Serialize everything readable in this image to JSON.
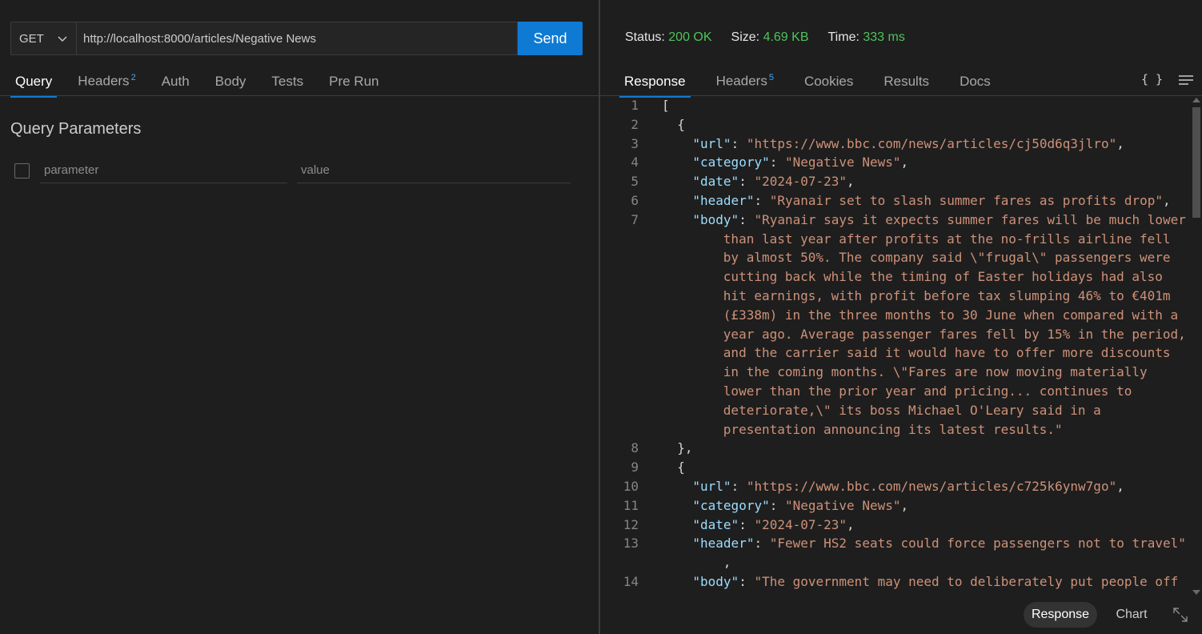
{
  "request": {
    "method": "GET",
    "url": "http://localhost:8000/articles/Negative News",
    "send_label": "Send"
  },
  "left_tabs": [
    {
      "label": "Query",
      "badge": "",
      "active": true
    },
    {
      "label": "Headers",
      "badge": "2",
      "active": false
    },
    {
      "label": "Auth",
      "badge": "",
      "active": false
    },
    {
      "label": "Body",
      "badge": "",
      "active": false
    },
    {
      "label": "Tests",
      "badge": "",
      "active": false
    },
    {
      "label": "Pre Run",
      "badge": "",
      "active": false
    }
  ],
  "query": {
    "title": "Query Parameters",
    "param_placeholder": "parameter",
    "value_placeholder": "value"
  },
  "status": {
    "status_label": "Status:",
    "status_value": "200 OK",
    "size_label": "Size:",
    "size_value": "4.69 KB",
    "time_label": "Time:",
    "time_value": "333 ms"
  },
  "right_tabs": [
    {
      "label": "Response",
      "badge": "",
      "active": true
    },
    {
      "label": "Headers",
      "badge": "5",
      "active": false
    },
    {
      "label": "Cookies",
      "badge": "",
      "active": false
    },
    {
      "label": "Results",
      "badge": "",
      "active": false
    },
    {
      "label": "Docs",
      "badge": "",
      "active": false
    }
  ],
  "braces_label": "{ }",
  "editor_lines": [
    {
      "ln": "1",
      "indent": 0,
      "parts": [
        [
          "punc",
          "["
        ]
      ]
    },
    {
      "ln": "2",
      "indent": 1,
      "parts": [
        [
          "punc",
          "{"
        ]
      ]
    },
    {
      "ln": "3",
      "indent": 2,
      "parts": [
        [
          "key",
          "\"url\""
        ],
        [
          "punc",
          ": "
        ],
        [
          "str",
          "\"https://www.bbc.com/news/articles/cj50d6q3jlro\""
        ],
        [
          "punc",
          ","
        ]
      ]
    },
    {
      "ln": "4",
      "indent": 2,
      "parts": [
        [
          "key",
          "\"category\""
        ],
        [
          "punc",
          ": "
        ],
        [
          "str",
          "\"Negative News\""
        ],
        [
          "punc",
          ","
        ]
      ]
    },
    {
      "ln": "5",
      "indent": 2,
      "parts": [
        [
          "key",
          "\"date\""
        ],
        [
          "punc",
          ": "
        ],
        [
          "str",
          "\"2024-07-23\""
        ],
        [
          "punc",
          ","
        ]
      ]
    },
    {
      "ln": "6",
      "indent": 2,
      "parts": [
        [
          "key",
          "\"header\""
        ],
        [
          "punc",
          ": "
        ],
        [
          "str",
          "\"Ryanair set to slash summer fares as profits drop\""
        ],
        [
          "punc",
          ","
        ]
      ]
    },
    {
      "ln": "7",
      "indent": 2,
      "parts": [
        [
          "key",
          "\"body\""
        ],
        [
          "punc",
          ": "
        ],
        [
          "str",
          "\"Ryanair says it expects summer fares will be much lower"
        ]
      ]
    },
    {
      "ln": "",
      "indent": 4,
      "parts": [
        [
          "str",
          "than last year after profits at the no-frills airline fell"
        ]
      ]
    },
    {
      "ln": "",
      "indent": 4,
      "parts": [
        [
          "str",
          "by almost 50%. The company said \\\"frugal\\\" passengers were"
        ]
      ]
    },
    {
      "ln": "",
      "indent": 4,
      "parts": [
        [
          "str",
          "cutting back while the timing of Easter holidays had also"
        ]
      ]
    },
    {
      "ln": "",
      "indent": 4,
      "parts": [
        [
          "str",
          "hit earnings, with profit before tax slumping 46% to €401m"
        ]
      ]
    },
    {
      "ln": "",
      "indent": 4,
      "parts": [
        [
          "str",
          "(£338m) in the three months to 30 June when compared with a"
        ]
      ]
    },
    {
      "ln": "",
      "indent": 4,
      "parts": [
        [
          "str",
          "year ago. Average passenger fares fell by 15% in the period,"
        ]
      ]
    },
    {
      "ln": "",
      "indent": 4,
      "parts": [
        [
          "str",
          "and the carrier said it would have to offer more discounts"
        ]
      ]
    },
    {
      "ln": "",
      "indent": 4,
      "parts": [
        [
          "str",
          "in the coming months. \\\"Fares are now moving materially"
        ]
      ]
    },
    {
      "ln": "",
      "indent": 4,
      "parts": [
        [
          "str",
          "lower than the prior year and pricing... continues to"
        ]
      ]
    },
    {
      "ln": "",
      "indent": 4,
      "parts": [
        [
          "str",
          "deteriorate,\\\" its boss Michael O'Leary said in a"
        ]
      ]
    },
    {
      "ln": "",
      "indent": 4,
      "parts": [
        [
          "str",
          "presentation announcing its latest results.\""
        ]
      ]
    },
    {
      "ln": "8",
      "indent": 1,
      "parts": [
        [
          "punc",
          "},"
        ]
      ]
    },
    {
      "ln": "9",
      "indent": 1,
      "parts": [
        [
          "punc",
          "{"
        ]
      ]
    },
    {
      "ln": "10",
      "indent": 2,
      "parts": [
        [
          "key",
          "\"url\""
        ],
        [
          "punc",
          ": "
        ],
        [
          "str",
          "\"https://www.bbc.com/news/articles/c725k6ynw7go\""
        ],
        [
          "punc",
          ","
        ]
      ]
    },
    {
      "ln": "11",
      "indent": 2,
      "parts": [
        [
          "key",
          "\"category\""
        ],
        [
          "punc",
          ": "
        ],
        [
          "str",
          "\"Negative News\""
        ],
        [
          "punc",
          ","
        ]
      ]
    },
    {
      "ln": "12",
      "indent": 2,
      "parts": [
        [
          "key",
          "\"date\""
        ],
        [
          "punc",
          ": "
        ],
        [
          "str",
          "\"2024-07-23\""
        ],
        [
          "punc",
          ","
        ]
      ]
    },
    {
      "ln": "13",
      "indent": 2,
      "parts": [
        [
          "key",
          "\"header\""
        ],
        [
          "punc",
          ": "
        ],
        [
          "str",
          "\"Fewer HS2 seats could force passengers not to travel\""
        ]
      ]
    },
    {
      "ln": "",
      "indent": 4,
      "parts": [
        [
          "punc",
          ","
        ]
      ]
    },
    {
      "ln": "14",
      "indent": 2,
      "parts": [
        [
          "key",
          "\"body\""
        ],
        [
          "punc",
          ": "
        ],
        [
          "str",
          "\"The government may need to deliberately put people off"
        ]
      ]
    }
  ],
  "bottom": {
    "response_label": "Response",
    "chart_label": "Chart"
  }
}
